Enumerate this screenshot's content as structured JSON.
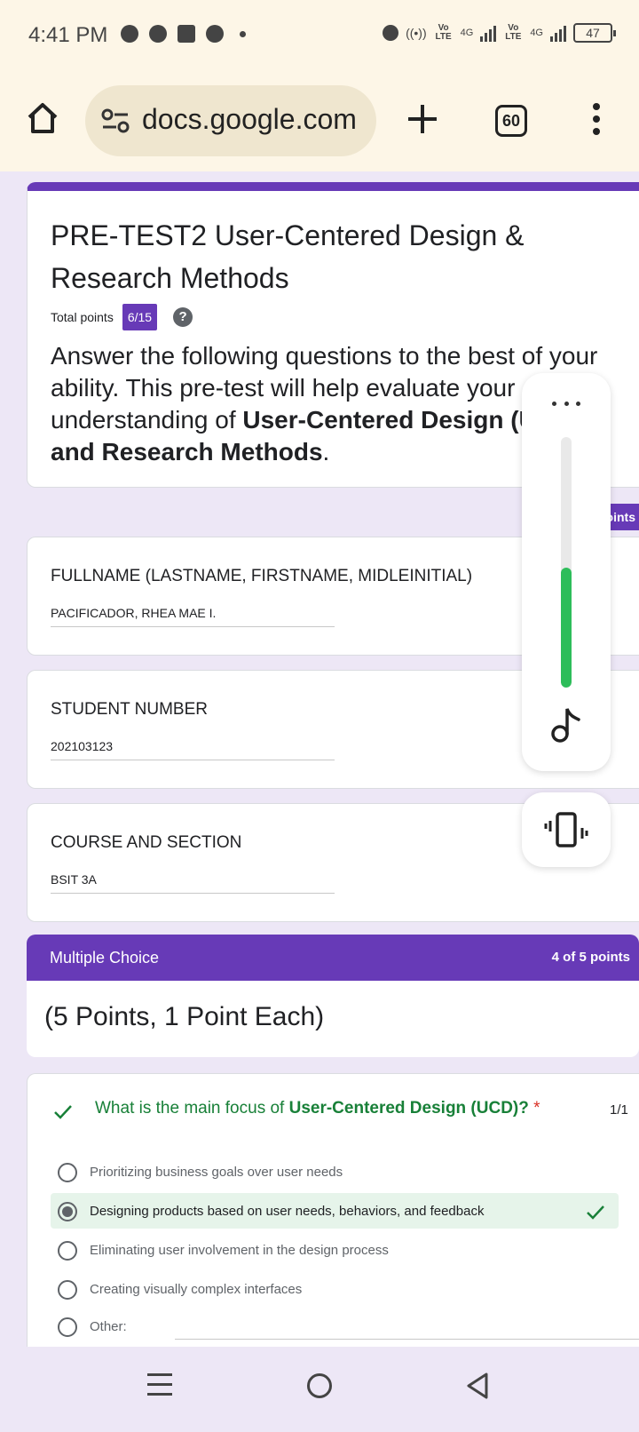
{
  "status_bar": {
    "time": "4:41 PM",
    "icons": [
      "messenger-icon",
      "alarm-icon",
      "facebook-icon",
      "chrome-icon",
      "dot-icon"
    ],
    "right_icons": [
      "alarm-icon",
      "hotspot-icon",
      "signal-icon",
      "signal-icon"
    ],
    "volte1": "Vo LTE",
    "net1": "4G",
    "volte2": "Vo LTE",
    "net2": "4G",
    "battery": "47"
  },
  "browser": {
    "url": "docs.google.com",
    "tab_count": "60",
    "icons": [
      "home-icon",
      "tune-icon",
      "plus-icon",
      "tabs-icon",
      "more-vertical-icon"
    ]
  },
  "form": {
    "title": "PRE-TEST2 User-Centered Design & Research Methods",
    "total_points_label": "Total points",
    "total_points_value": "6/15",
    "description_prefix": "Answer the following questions to the best of your ability. This pre-test will help evaluate your understanding of ",
    "description_bold1": "User-Centered Design (UCD)",
    "description_mid": " and Research Methods",
    "description_end": ".",
    "points_tab": "points",
    "fields": [
      {
        "label": "FULLNAME (LASTNAME, FIRSTNAME, MIDLEINITIAL)",
        "value": "PACIFICADOR, RHEA MAE I."
      },
      {
        "label": "STUDENT NUMBER",
        "value": "202103123"
      },
      {
        "label": "COURSE AND SECTION",
        "value": "BSIT 3A"
      }
    ],
    "section": {
      "title": "Multiple Choice",
      "points": "4 of 5 points",
      "subtitle": "(5 Points, 1 Point Each)"
    },
    "question": {
      "prefix": "What is the main focus of ",
      "bold": "User-Centered Design (UCD)?",
      "required": "*",
      "score": "1/1",
      "options": [
        {
          "label": "Prioritizing business goals over user needs",
          "selected": false
        },
        {
          "label": "Designing products based on user needs, behaviors, and feedback",
          "selected": true
        },
        {
          "label": "Eliminating user involvement in the design process",
          "selected": false
        },
        {
          "label": "Creating visually complex interfaces",
          "selected": false
        },
        {
          "label": "Other:",
          "selected": false
        }
      ]
    }
  },
  "volume_panel": {
    "level": 0.48,
    "accent": "#2dbd5a",
    "icons": [
      "more-horizontal-icon",
      "music-note-icon",
      "vibrate-icon"
    ]
  },
  "colors": {
    "form_accent": "#673ab7",
    "correct_green": "#188038",
    "page_bg": "#ede7f6"
  },
  "nav": {
    "icons": [
      "recents-icon",
      "home-icon",
      "back-icon"
    ]
  }
}
